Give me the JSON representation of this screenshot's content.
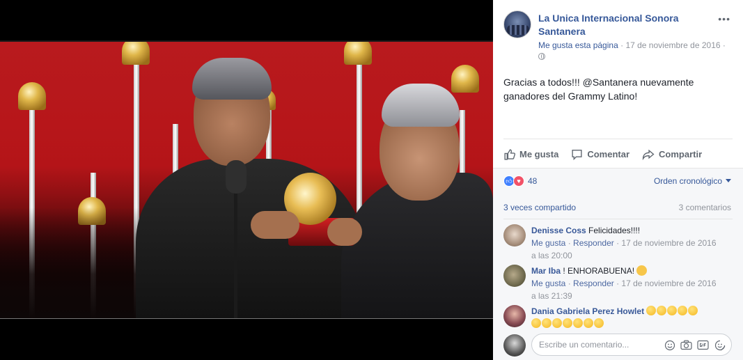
{
  "post": {
    "page_name": "La Unica Internacional Sonora Santanera",
    "page_link": "Me gusta esta página",
    "date": "17 de noviembre de 2016",
    "text": "Gracias a todos!!! @Santanera nuevamente ganadores del Grammy Latino!"
  },
  "actions": {
    "like": "Me gusta",
    "comment": "Comentar",
    "share": "Compartir"
  },
  "stats": {
    "reaction_count": "48",
    "order": "Orden cronológico",
    "shares": "3 veces compartido",
    "comments": "3 comentarios"
  },
  "comments": [
    {
      "author": "Denisse Coss",
      "text": "Felicidades!!!!",
      "like": "Me gusta",
      "reply": "Responder",
      "date": "17 de noviembre de 2016",
      "time": "a las 20:00"
    },
    {
      "author": "Mar Iba",
      "text": "! ENHORABUENA!",
      "like": "Me gusta",
      "reply": "Responder",
      "date": "17 de noviembre de 2016",
      "time": "a las 21:39"
    },
    {
      "author": "Dania Gabriela Perez Howlet",
      "text": "",
      "emoji_count_line1": 5,
      "emoji_count_line2": 7
    }
  ],
  "composer": {
    "placeholder": "Escribe un comentario..."
  },
  "colors": {
    "link": "#365899",
    "muted": "#90949c",
    "like_blue": "#4080ff",
    "love_red": "#f25268",
    "panel_bg": "#f6f7f9"
  },
  "icons": [
    "more-icon",
    "globe-icon",
    "like-icon",
    "comment-icon",
    "share-icon",
    "emoji-icon",
    "camera-icon",
    "gif-icon",
    "sticker-icon"
  ]
}
